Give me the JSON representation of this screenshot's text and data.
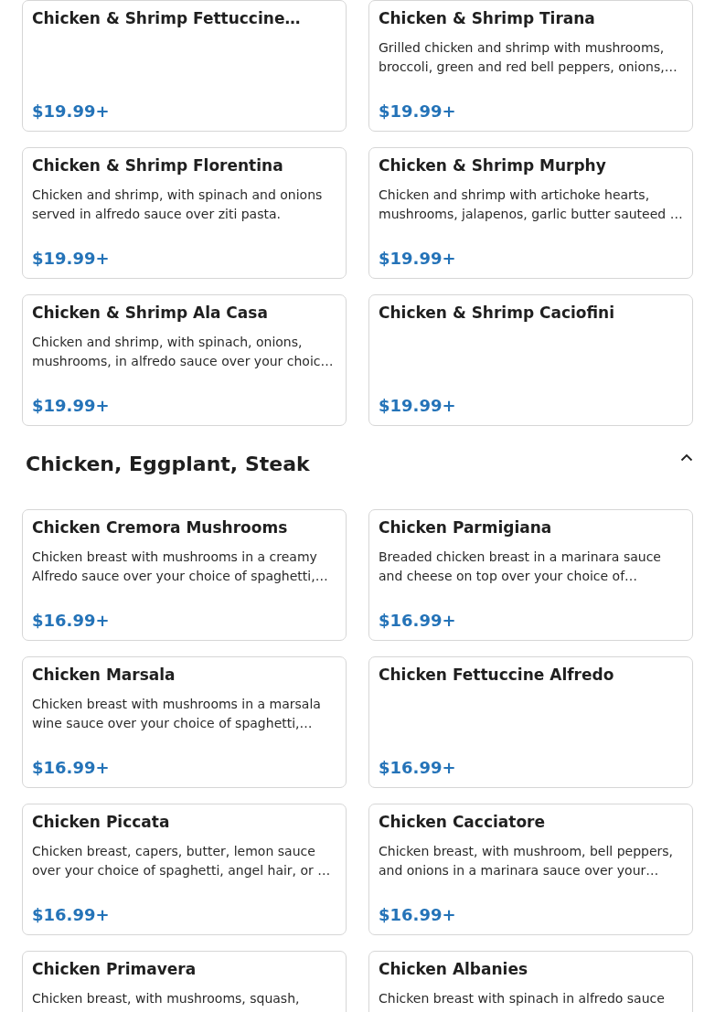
{
  "sections": [
    {
      "items": [
        {
          "name": "Chicken & Shrimp Fettuccine…",
          "price": "$19.99+"
        },
        {
          "name": "Chicken & Shrimp Tirana",
          "description": "Grilled chicken and shrimp with mushrooms, broccoli, green and red bell peppers, onions,…",
          "price": "$19.99+"
        },
        {
          "name": "Chicken & Shrimp Florentina",
          "description": "Chicken and shrimp, with spinach and onions served in alfredo sauce over ziti pasta.",
          "price": "$19.99+"
        },
        {
          "name": "Chicken & Shrimp Murphy",
          "description": "Chicken and shrimp with artichoke hearts, mushrooms, jalapenos, garlic butter sauteed …",
          "price": "$19.99+"
        },
        {
          "name": "Chicken & Shrimp Ala Casa",
          "description": "Chicken and shrimp, with spinach, onions, mushrooms, in alfredo sauce over your choic…",
          "price": "$19.99+"
        },
        {
          "name": "Chicken & Shrimp Caciofini",
          "price": "$19.99+"
        }
      ]
    },
    {
      "title": "Chicken, Eggplant, Steak",
      "expanded": true,
      "items": [
        {
          "name": "Chicken Cremora Mushrooms",
          "description": "Chicken breast with mushrooms in a creamy Alfredo sauce over your choice of spaghetti,…",
          "price": "$16.99+"
        },
        {
          "name": "Chicken Parmigiana",
          "description": "Breaded chicken breast in a marinara sauce and cheese on top over your choice of…",
          "price": "$16.99+"
        },
        {
          "name": "Chicken Marsala",
          "description": "Chicken breast with mushrooms in a marsala wine sauce over your choice of spaghetti,…",
          "price": "$16.99+"
        },
        {
          "name": "Chicken Fettuccine Alfredo",
          "price": "$16.99+"
        },
        {
          "name": "Chicken Piccata",
          "description": "Chicken breast, capers, butter, lemon sauce over your choice of spaghetti, angel hair, or …",
          "price": "$16.99+"
        },
        {
          "name": "Chicken Cacciatore",
          "description": "Chicken breast, with mushroom, bell peppers, and onions in a marinara sauce over your…",
          "price": "$16.99+"
        },
        {
          "name": "Chicken Primavera",
          "description": "Chicken breast, with mushrooms, squash,"
        },
        {
          "name": "Chicken Albanies",
          "description": "Chicken breast with spinach in alfredo sauce"
        }
      ]
    }
  ]
}
